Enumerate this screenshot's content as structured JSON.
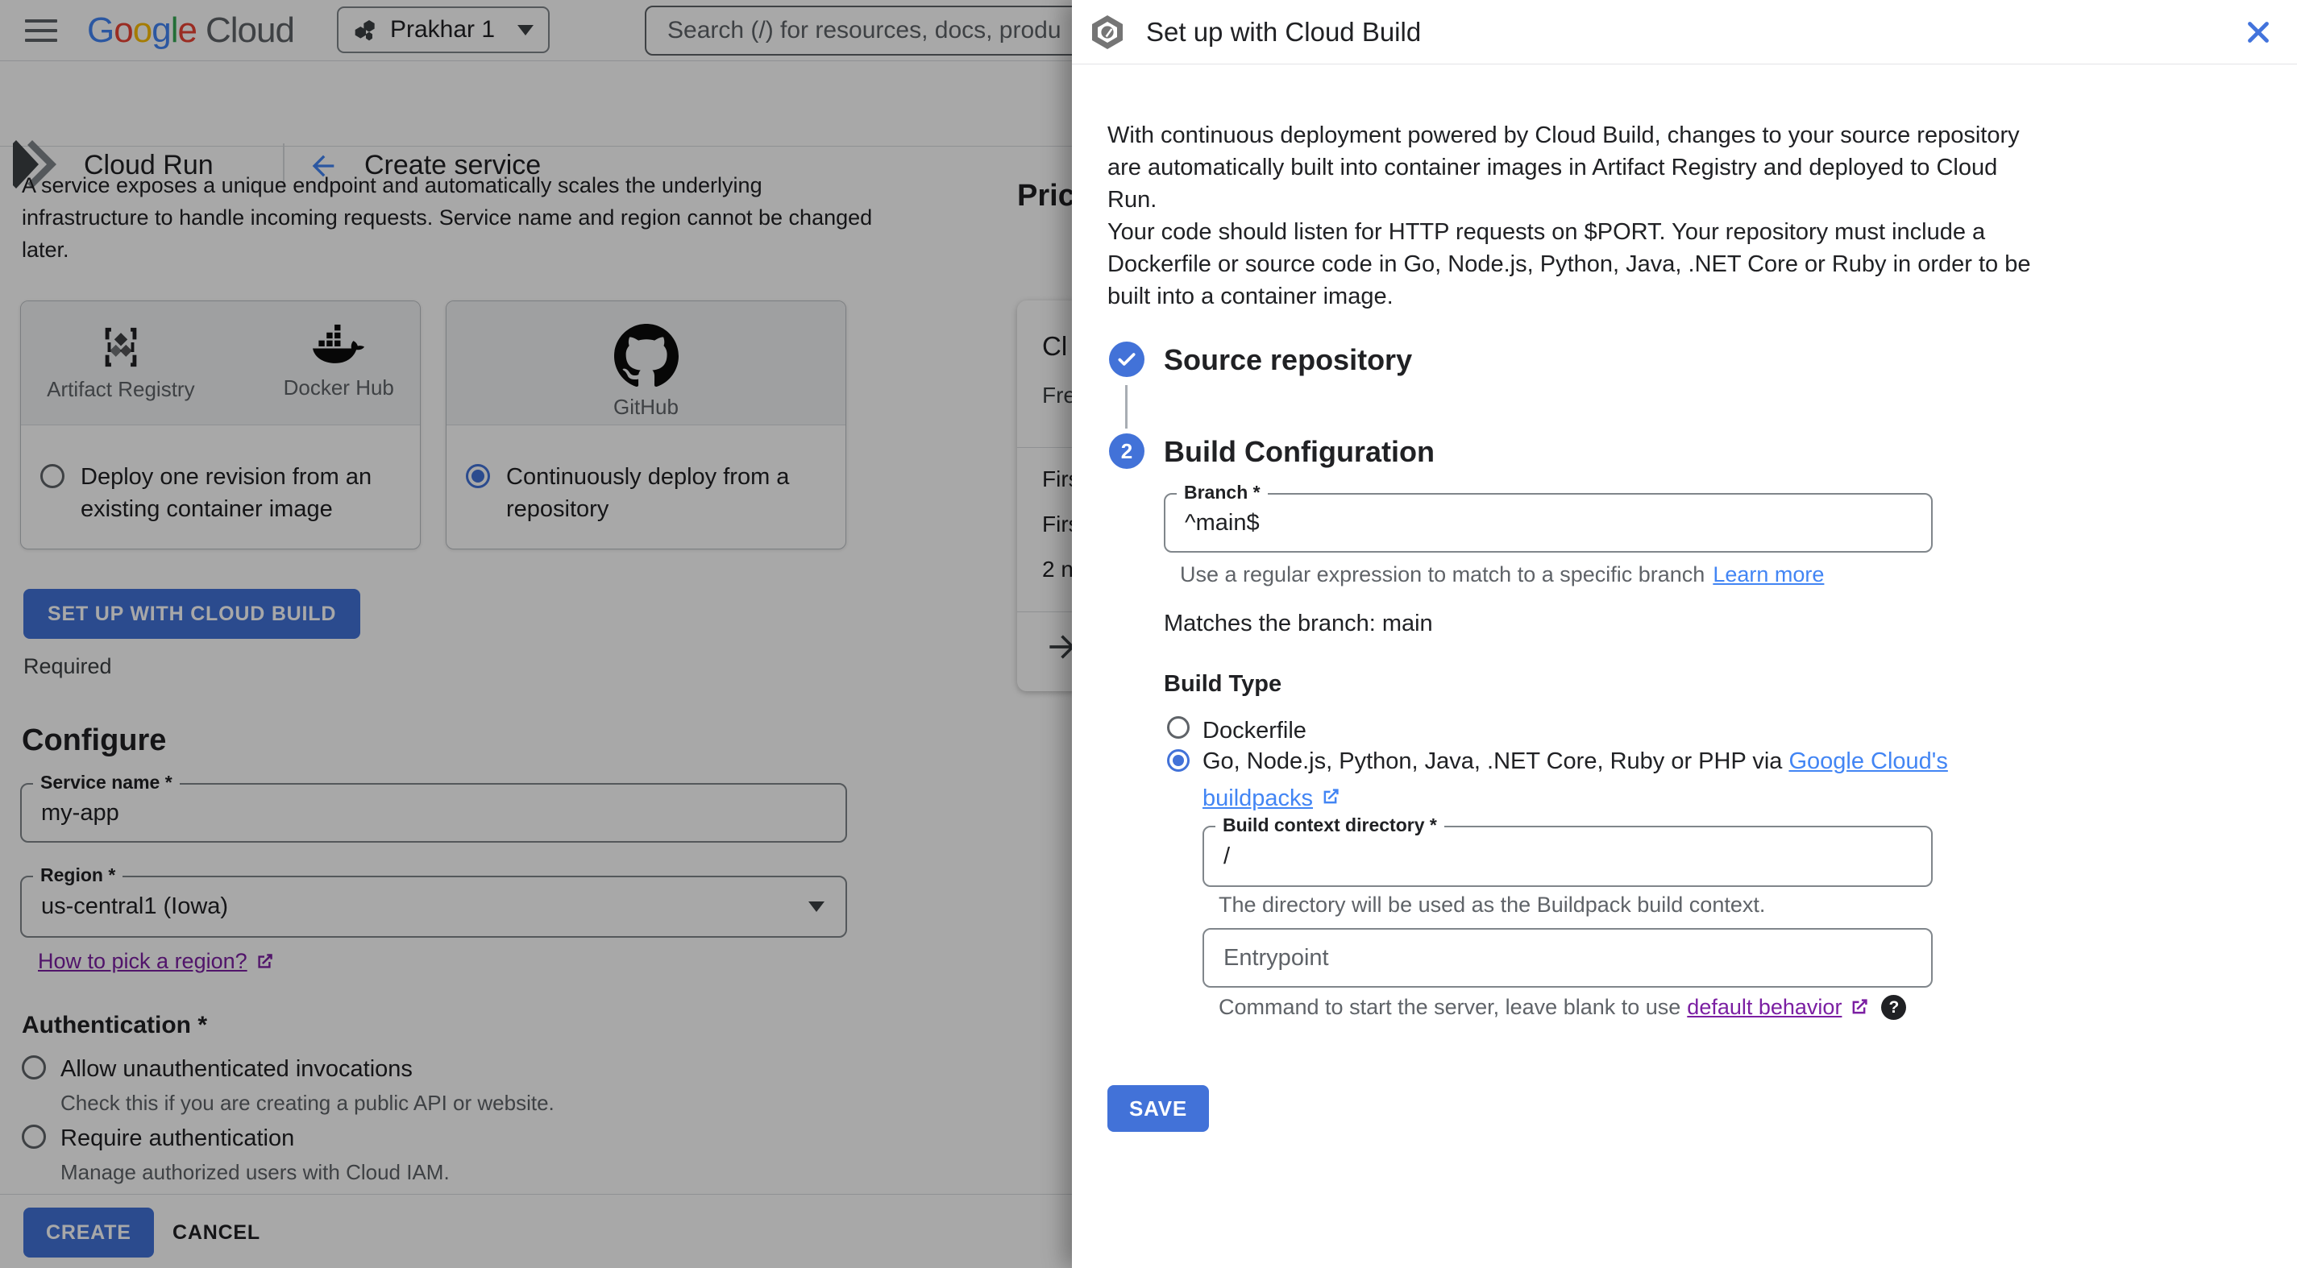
{
  "topbar": {
    "logo_letters": [
      {
        "ch": "G",
        "c": "#4285F4"
      },
      {
        "ch": "o",
        "c": "#EA4335"
      },
      {
        "ch": "o",
        "c": "#FBBC04"
      },
      {
        "ch": "g",
        "c": "#4285F4"
      },
      {
        "ch": "l",
        "c": "#34A853"
      },
      {
        "ch": "e",
        "c": "#EA4335"
      }
    ],
    "logo_cloud": "Cloud",
    "project_name": "Prakhar 1",
    "search_placeholder": "Search (/) for resources, docs, produ"
  },
  "header": {
    "product": "Cloud Run",
    "page_title": "Create service"
  },
  "main": {
    "intro_lines": [
      "A service exposes a unique endpoint and automatically scales the underlying",
      "infrastructure to handle incoming requests. Service name and region cannot be changed",
      "later."
    ],
    "cards": {
      "image_card": {
        "providers": [
          {
            "label": "Artifact Registry"
          },
          {
            "label": "Docker Hub"
          }
        ],
        "option_lines": [
          "Deploy one revision from an",
          "existing container image"
        ],
        "selected": false
      },
      "repo_card": {
        "providers": [
          {
            "label": "GitHub"
          }
        ],
        "option_lines": [
          "Continuously deploy from a",
          "repository"
        ],
        "selected": true
      }
    },
    "setup_button": "SET UP WITH CLOUD BUILD",
    "required_label": "Required",
    "configure": {
      "title": "Configure",
      "service_name_label": "Service name *",
      "service_name_value": "my-app",
      "region_label": "Region *",
      "region_value": "us-central1 (Iowa)",
      "region_help_link": "How to pick a region?"
    },
    "authentication": {
      "title": "Authentication *",
      "options": [
        {
          "label": "Allow unauthenticated invocations",
          "description": "Check this if you are creating a public API or website.",
          "selected": false
        },
        {
          "label": "Require authentication",
          "description": "Manage authorized users with Cloud IAM.",
          "selected": false
        }
      ]
    },
    "footer": {
      "create": "CREATE",
      "cancel": "CANCEL"
    }
  },
  "pricing_preview": {
    "title_partial": "Pric",
    "row1_partial": "Cl",
    "row2_partial": "Fre",
    "row3_partial": "Firs",
    "row4_partial": "Firs",
    "row5_partial": "2 n"
  },
  "panel": {
    "title": "Set up with Cloud Build",
    "description_lines": [
      "With continuous deployment powered by Cloud Build, changes to your source repository",
      "are automatically built into container images in Artifact Registry and deployed to Cloud",
      "Run.",
      "Your code should listen for HTTP requests on $PORT. Your repository must include a",
      "Dockerfile or source code in Go, Node.js, Python, Java, .NET Core or Ruby in order to be",
      "built into a container image."
    ],
    "steps": {
      "step1_title": "Source repository",
      "step2_number": "2",
      "step2_title": "Build Configuration"
    },
    "branch": {
      "label": "Branch *",
      "value": "^main$",
      "helper": "Use a regular expression to match to a specific branch",
      "helper_link": "Learn more"
    },
    "match_note": "Matches the branch: main",
    "build_type": {
      "label": "Build Type",
      "option1": "Dockerfile",
      "option2_prefix": "Go, Node.js, Python, Java, .NET Core, Ruby or PHP via ",
      "option2_link_line1": "Google Cloud's",
      "option2_link_line2": "buildpacks",
      "selected_option": 2
    },
    "context_dir": {
      "label": "Build context directory *",
      "value": "/",
      "helper": "The directory will be used as the Buildpack build context."
    },
    "entrypoint": {
      "placeholder": "Entrypoint",
      "helper_prefix": "Command to start the server, leave blank to use ",
      "helper_link": "default behavior"
    },
    "save_button": "SAVE"
  },
  "colors": {
    "accent_blue": "#4272d8",
    "link_blue": "#4285f4",
    "link_purple": "#7b1fa2",
    "google_blue": "#4285F4",
    "google_red": "#EA4335",
    "google_yellow": "#FBBC04",
    "google_green": "#34A853",
    "scrim": "rgba(0,0,0,0.34)"
  }
}
